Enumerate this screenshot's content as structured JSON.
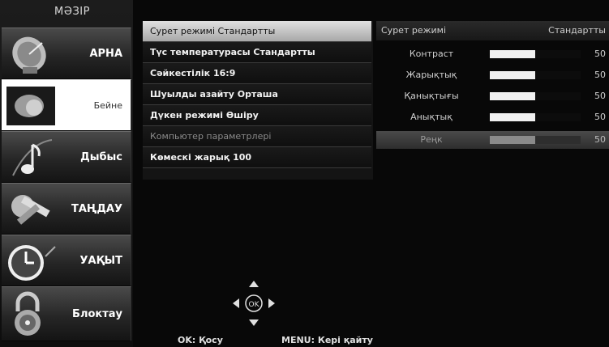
{
  "menu": {
    "title": "МӘЗІР"
  },
  "sidebar": {
    "items": [
      {
        "label": "АРНА",
        "icon": "satellite-dish-icon"
      },
      {
        "label": "Бейне",
        "icon": "picture-icon"
      },
      {
        "label": "Дыбыс",
        "icon": "music-note-icon"
      },
      {
        "label": "ТАҢДАУ",
        "icon": "tools-icon"
      },
      {
        "label": "УАҚЫТ",
        "icon": "clock-icon"
      },
      {
        "label": "Блоктау",
        "icon": "padlock-icon"
      }
    ],
    "active_index": 1
  },
  "options": [
    {
      "label": "Сурет режимі",
      "value": "Стандартты"
    },
    {
      "label": "Түс температурасы",
      "value": "Стандартты"
    },
    {
      "label": "Сәйкестілік",
      "value": "16:9"
    },
    {
      "label": "Шуылды азайту",
      "value": "Орташа"
    },
    {
      "label": "Дүкен режимі",
      "value": "Өшіру"
    },
    {
      "label": "Компьютер параметрлері",
      "value": ""
    },
    {
      "label": "Көмескі жарық",
      "value": "100"
    }
  ],
  "submenu": {
    "header_label": "Сурет режимі",
    "header_value": "Стандартты",
    "sliders": [
      {
        "name": "Контраст",
        "value": 50
      },
      {
        "name": "Жарықтық",
        "value": 50
      },
      {
        "name": "Қанықтығы",
        "value": 50
      },
      {
        "name": "Анықтық",
        "value": 50
      },
      {
        "name": "Реңк",
        "value": 50
      }
    ]
  },
  "footer": {
    "ok_hint": "OK: Қосу",
    "menu_hint": "MENU: Кері қайту",
    "ok_button": "OK"
  },
  "colors": {
    "highlight": "#c8c8c8",
    "background": "#080808"
  }
}
